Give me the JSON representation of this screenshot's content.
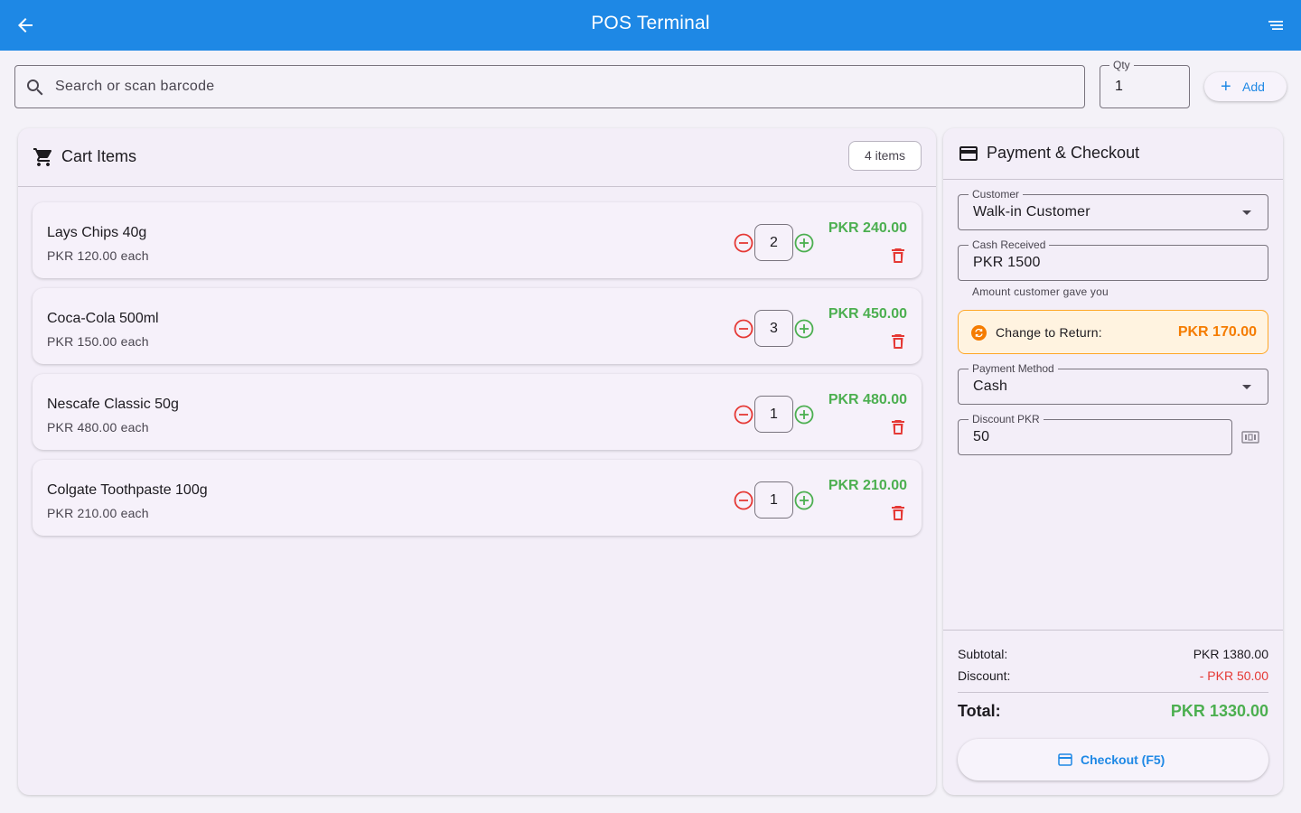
{
  "appbar": {
    "title": "POS Terminal"
  },
  "search": {
    "placeholder": "Search or scan barcode"
  },
  "qty": {
    "label": "Qty",
    "value": "1"
  },
  "add_button": {
    "label": "Add"
  },
  "cart": {
    "title": "Cart Items",
    "count_label": "4 items",
    "items": [
      {
        "name": "Lays Chips 40g",
        "each": "PKR 120.00 each",
        "qty": "2",
        "total": "PKR 240.00"
      },
      {
        "name": "Coca-Cola 500ml",
        "each": "PKR 150.00 each",
        "qty": "3",
        "total": "PKR 450.00"
      },
      {
        "name": "Nescafe Classic 50g",
        "each": "PKR 480.00 each",
        "qty": "1",
        "total": "PKR 480.00"
      },
      {
        "name": "Colgate Toothpaste 100g",
        "each": "PKR 210.00 each",
        "qty": "1",
        "total": "PKR 210.00"
      }
    ]
  },
  "payment": {
    "title": "Payment & Checkout",
    "customer": {
      "label": "Customer",
      "value": "Walk-in Customer"
    },
    "cash": {
      "label": "Cash Received",
      "value": "PKR 1500",
      "helper": "Amount customer gave you"
    },
    "change": {
      "label": "Change to Return:",
      "amount": "PKR 170.00"
    },
    "method": {
      "label": "Payment Method",
      "value": "Cash"
    },
    "discount": {
      "label": "Discount PKR",
      "value": "50"
    },
    "summary": {
      "subtotal_label": "Subtotal:",
      "subtotal": "PKR 1380.00",
      "discount_label": "Discount:",
      "discount": "- PKR 50.00",
      "total_label": "Total:",
      "total": "PKR 1330.00"
    },
    "checkout_label": "Checkout (F5)"
  },
  "colors": {
    "primary": "#1e88e5",
    "success": "#4caf50",
    "danger": "#e53935",
    "warning": "#f57c00"
  }
}
